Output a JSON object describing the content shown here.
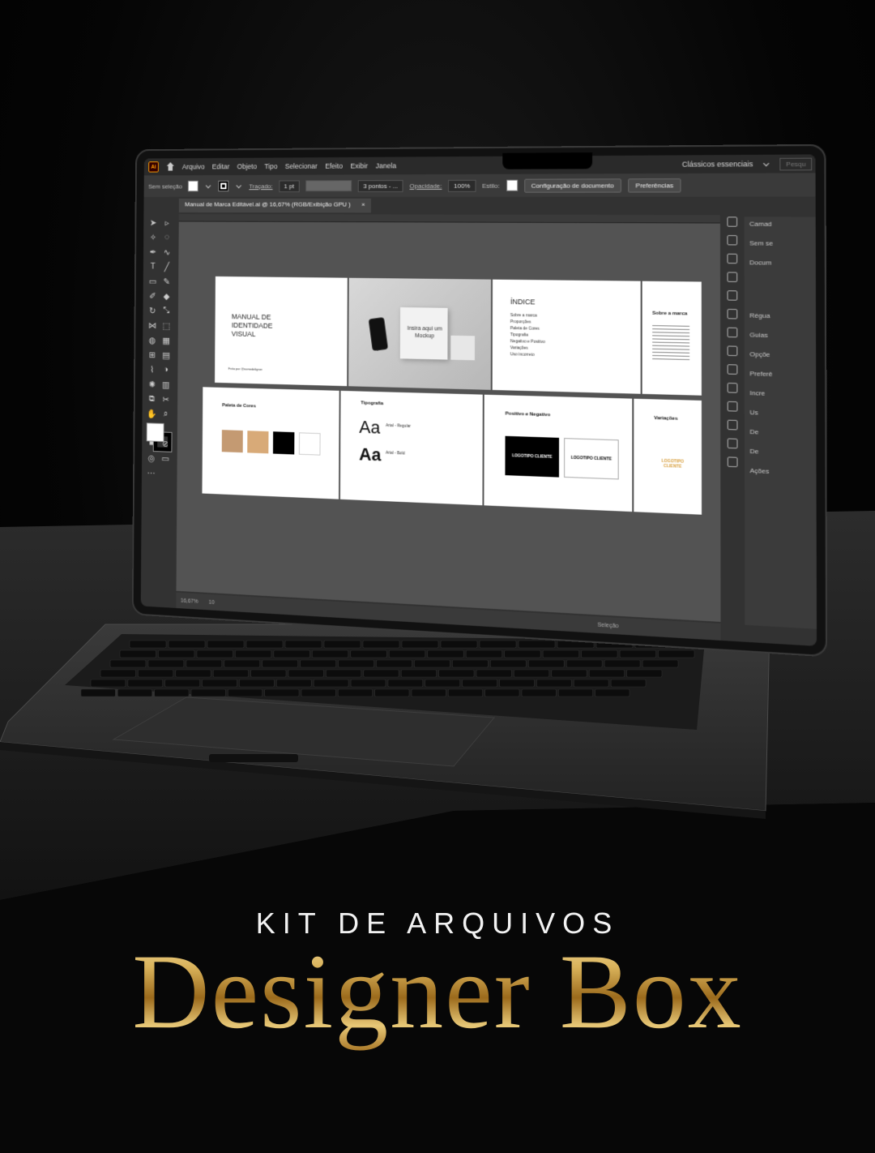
{
  "menubar": {
    "app_badge": "Ai",
    "items": [
      "Arquivo",
      "Editar",
      "Objeto",
      "Tipo",
      "Selecionar",
      "Efeito",
      "Exibir",
      "Janela"
    ],
    "workspace": "Clássicos essenciais",
    "search_placeholder": "Pesqu"
  },
  "controlbar": {
    "selection": "Sem seleção",
    "stroke_label": "Traçado:",
    "stroke_value": "1 pt",
    "brush": "3 pontos - ...",
    "opacity_label": "Opacidade:",
    "opacity_value": "100%",
    "style_label": "Estilo:",
    "doc_setup_button": "Configuração de documento",
    "prefs_button": "Preferências"
  },
  "document": {
    "tab_title": "Manual de Marca Editável.ai @ 16,67% (RGB/Exibição GPU )",
    "tab_close": "×"
  },
  "artboards": {
    "cover": {
      "title": "MANUAL DE IDENTIDADE VISUAL",
      "footer": "Feito por @nomedeligner"
    },
    "mockup": {
      "label": "Insira aqui um Mockup"
    },
    "index": {
      "title": "ÍNDICE",
      "items": [
        "Sobre a marca",
        "Proporções",
        "Paleta de Cores",
        "Tipografia",
        "Negativo e Positivo",
        "Variações",
        "Uso incorreto"
      ]
    },
    "about": {
      "title": "Sobre a marca"
    },
    "palette": {
      "title": "Paleta de Cores",
      "colors": [
        "#c49a72",
        "#d8aa78",
        "#000000",
        "#ffffff"
      ]
    },
    "typography": {
      "title": "Tipografia",
      "glyph": "Aa",
      "regular": "Arial - Regular",
      "bold": "Arial - Bold"
    },
    "negative": {
      "title": "Positivo e Negativo",
      "logo": "LOGOTIPO CLIENTE"
    },
    "variations": {
      "title": "Variações",
      "logo": "LOGOTIPO CLIENTE"
    }
  },
  "panel": {
    "items": [
      "Camad",
      "Sem se",
      "Docum",
      "Régua",
      "Guias",
      "Opçõe",
      "Preferê",
      "Incre",
      "Us",
      "De",
      "De",
      "Ações"
    ]
  },
  "statusbar": {
    "zoom": "16,67%",
    "page": "10",
    "tool": "Seleção"
  },
  "title": {
    "kicker": "KIT DE ARQUIVOS",
    "brand": "Designer Box"
  },
  "colors": {
    "gold": "#d9b25a",
    "ui_bg": "#323232"
  }
}
